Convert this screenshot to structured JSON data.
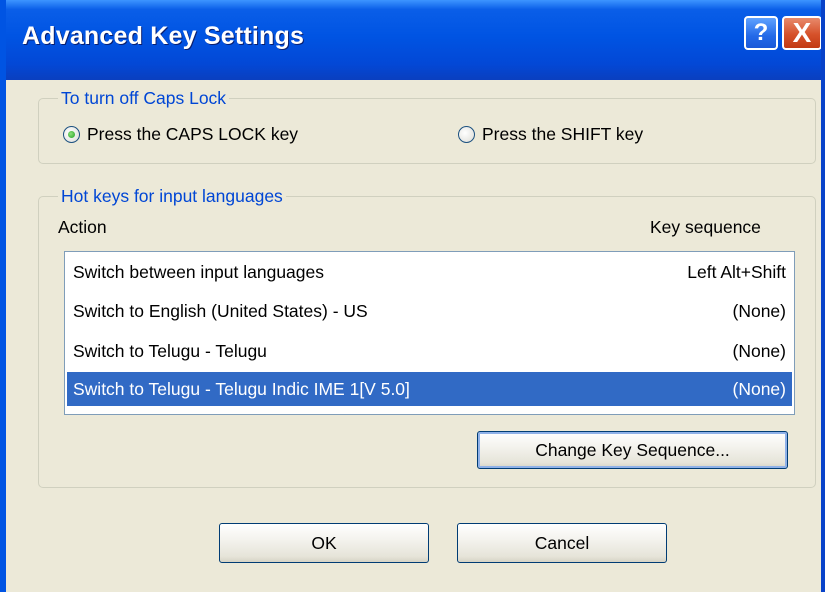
{
  "window": {
    "title": "Advanced Key Settings",
    "help_label": "?",
    "close_label": "X"
  },
  "caps_lock": {
    "caption": "To turn off Caps Lock",
    "options": [
      {
        "label": "Press the CAPS LOCK key",
        "selected": true
      },
      {
        "label": "Press the SHIFT key",
        "selected": false
      }
    ]
  },
  "hotkeys": {
    "caption": "Hot keys for input languages",
    "col_action": "Action",
    "col_keyseq": "Key sequence",
    "rows": [
      {
        "action": "Switch between input languages",
        "keys": "Left Alt+Shift",
        "selected": false
      },
      {
        "action": "Switch to English (United States) - US",
        "keys": "(None)",
        "selected": false
      },
      {
        "action": "Switch to Telugu - Telugu",
        "keys": "(None)",
        "selected": false
      },
      {
        "action": "Switch to Telugu - Telugu Indic IME 1[V 5.0]",
        "keys": "(None)",
        "selected": true
      }
    ],
    "change_button": "Change Key Sequence..."
  },
  "footer": {
    "ok_label": "OK",
    "cancel_label": "Cancel"
  },
  "colors": {
    "titlebar": "#0054e3",
    "dialog_bg": "#ece9d8",
    "group_caption": "#0046d5",
    "selection": "#316ac5"
  }
}
